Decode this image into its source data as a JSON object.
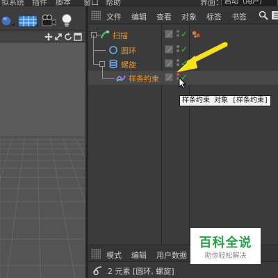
{
  "menubar": {
    "items": [
      "拟系统",
      "插件",
      "脚本",
      "窗口",
      "帮助"
    ],
    "layout_label": "界面：",
    "layout_value": "启动（用户）"
  },
  "viewport": {
    "toolbar_icons": [
      "sphere-primitive-icon",
      "floor-grid-icon",
      "camera-icon",
      "light-bulb-icon"
    ],
    "nav_icons": [
      "move-view-icon",
      "zoom-view-icon",
      "rotate-view-icon",
      "maximize-view-icon"
    ]
  },
  "object_manager": {
    "menu": [
      "文件",
      "编辑",
      "查看",
      "对象",
      "标签",
      "书签"
    ],
    "objects": [
      {
        "name": "扫描",
        "icon": "sweep-icon",
        "indent": 0,
        "tags": [
          "phong-tag-icon"
        ]
      },
      {
        "name": "圆环",
        "icon": "circle-spline-icon",
        "indent": 1,
        "tags": []
      },
      {
        "name": "螺旋",
        "icon": "helix-spline-icon",
        "indent": 1,
        "tags": []
      },
      {
        "name": "样条约束",
        "icon": "spline-wrap-icon",
        "indent": 2,
        "tags": []
      }
    ],
    "tooltip": "样条约束 对象 [样条约束]"
  },
  "attribute_manager": {
    "menu": [
      "模式",
      "编辑",
      "用户数据"
    ],
    "status": "2 元素 [圆环, 螺旋]"
  },
  "watermark": {
    "title": "百科全说",
    "subtitle": "助你轻松解决"
  },
  "colors": {
    "object_name": "#e5932c",
    "check": "#39c43a",
    "arrow": "#f5e21a"
  }
}
